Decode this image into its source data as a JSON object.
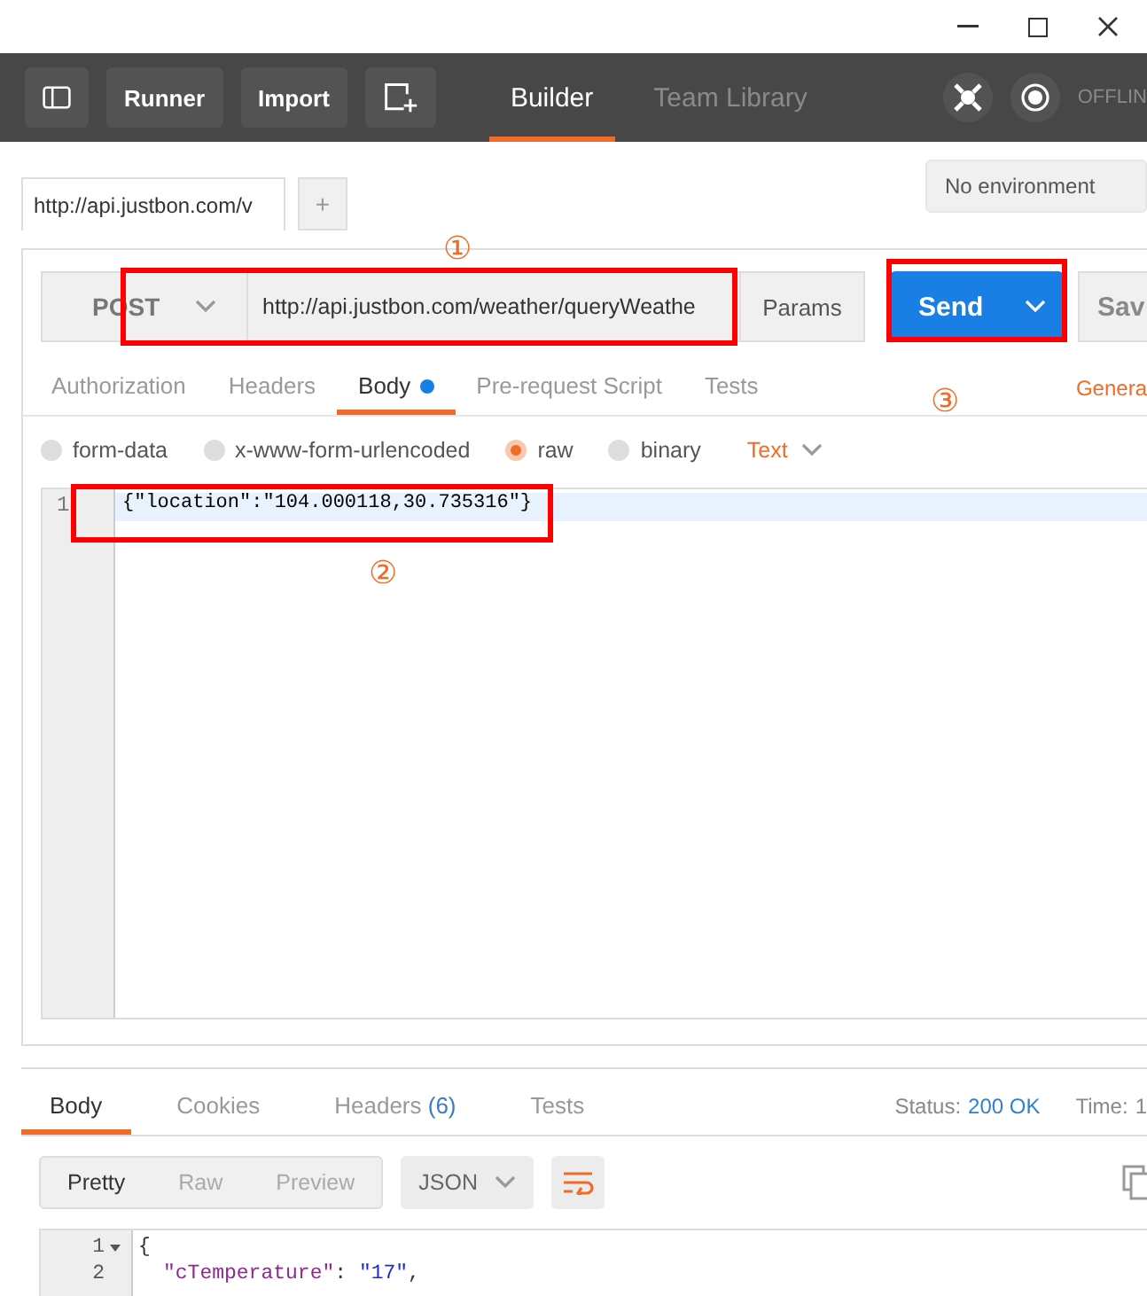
{
  "toolbar": {
    "buttons": [
      "Runner",
      "Import"
    ],
    "tabs": [
      {
        "label": "Builder",
        "selected": true
      },
      {
        "label": "Team Library",
        "selected": false
      }
    ],
    "status": "OFFLIN"
  },
  "request_tabs": [
    {
      "label": "http://api.justbon.com/v",
      "selected": true
    }
  ],
  "new_tab": "+",
  "environment": "No environment",
  "request": {
    "method": "POST",
    "url": "http://api.justbon.com/weather/queryWeathe",
    "params": "Params",
    "send": "Send",
    "save": "Sav"
  },
  "body_tabs": [
    {
      "label": "Authorization",
      "selected": false,
      "modified": false
    },
    {
      "label": "Headers",
      "selected": false,
      "modified": false
    },
    {
      "label": "Body",
      "selected": true,
      "modified": true
    },
    {
      "label": "Pre-request Script",
      "selected": false,
      "modified": false
    },
    {
      "label": "Tests",
      "selected": false,
      "modified": false
    }
  ],
  "generate": "Genera",
  "body_modes": [
    {
      "label": "form-data",
      "selected": false
    },
    {
      "label": "x-www-form-urlencoded",
      "selected": false
    },
    {
      "label": "raw",
      "selected": true
    },
    {
      "label": "binary",
      "selected": false
    }
  ],
  "format": "Text",
  "editor_lines": [
    {
      "number": "1",
      "code": "{\"location\":\"104.000118,30.735316\"}"
    }
  ],
  "annotations": [
    "①",
    "②",
    "③"
  ],
  "response": {
    "tabs": [
      {
        "label": "Body",
        "selected": true
      },
      {
        "label": "Cookies",
        "selected": false
      },
      {
        "label": "Headers",
        "count": "(6)",
        "selected": false
      },
      {
        "label": "Tests",
        "selected": false
      }
    ],
    "status_label": "Status:",
    "status": "200 OK",
    "time_label": "Time:",
    "time": "1",
    "view_modes": [
      {
        "label": "Pretty",
        "selected": true
      },
      {
        "label": "Raw",
        "selected": false
      },
      {
        "label": "Preview",
        "selected": false
      }
    ],
    "language": "JSON",
    "lines": [
      {
        "number": "1",
        "fold": true,
        "tokens": [
          {
            "text": "{",
            "kind": "punct"
          }
        ]
      },
      {
        "number": "2",
        "fold": false,
        "tokens": [
          {
            "text": "\"cTemperature\"",
            "kind": "key"
          },
          {
            "text": ": ",
            "kind": "punct"
          },
          {
            "text": "\"17\"",
            "kind": "string"
          },
          {
            "text": ",",
            "kind": "punct"
          }
        ]
      }
    ]
  }
}
